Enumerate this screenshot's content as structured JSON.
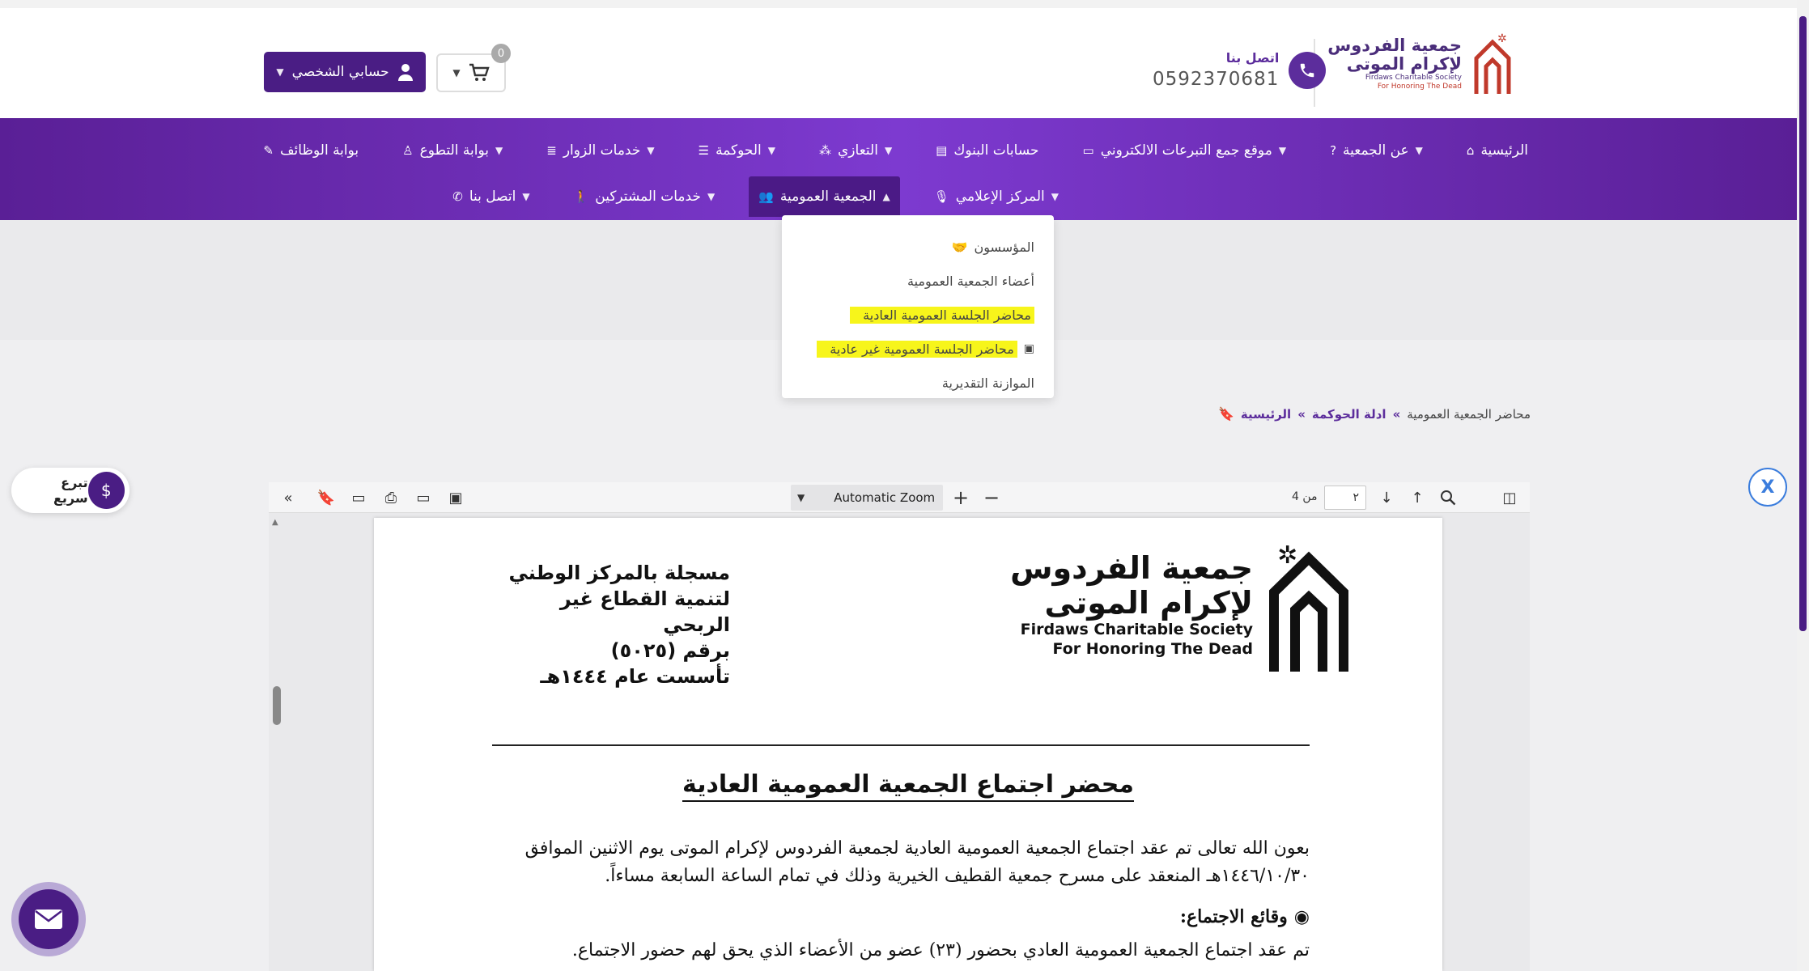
{
  "header": {
    "logo": {
      "line1": "جمعية الفردوس",
      "line2": "لإكرام الموتى",
      "en1": "Firdaws Charitable Society",
      "en2": "For Honoring The Dead"
    },
    "contact": {
      "label": "اتصل بنا",
      "phone": "0592370681"
    },
    "cart": {
      "count": "0"
    },
    "account": {
      "label": "حسابي الشخصي"
    }
  },
  "nav": {
    "row1": [
      {
        "label": "الرئيسية",
        "icon": "home-icon",
        "dropdown": false
      },
      {
        "label": "عن الجمعية",
        "icon": "question-icon",
        "dropdown": true
      },
      {
        "label": "موقع جمع التبرعات الالكتروني",
        "icon": "card-icon",
        "dropdown": true
      },
      {
        "label": "حسابات البنوك",
        "icon": "bank-icon",
        "dropdown": false
      },
      {
        "label": "التعازي",
        "icon": "grid-icon",
        "dropdown": true
      },
      {
        "label": "الحوكمة",
        "icon": "list-icon",
        "dropdown": true
      },
      {
        "label": "خدمات الزوار",
        "icon": "server-icon",
        "dropdown": true
      },
      {
        "label": "بوابة التطوع",
        "icon": "person-icon",
        "dropdown": true
      },
      {
        "label": "بوابة الوظائف",
        "icon": "edit-icon",
        "dropdown": false
      }
    ],
    "row2": [
      {
        "label": "المركز الإعلامي",
        "icon": "mic-icon",
        "dropdown": true
      },
      {
        "label": "الجمعية العمومية",
        "icon": "users-icon",
        "dropdown": true,
        "active": true
      },
      {
        "label": "خدمات المشتركين",
        "icon": "walk-icon",
        "dropdown": true
      },
      {
        "label": "اتصل بنا",
        "icon": "phone-icon",
        "dropdown": true
      }
    ],
    "dropdown_items": [
      "المؤسسون",
      "أعضاء الجمعية العمومية",
      "محاضر الجلسة العمومية العادية",
      "محاضر الجلسة العمومية غير عادية",
      "الموازنة التقديرية"
    ]
  },
  "breadcrumb": {
    "home": "الرئيسية",
    "sep": "»",
    "parent": "ادلة الحوكمة",
    "current": "محاضر الجمعية العمومية"
  },
  "floating": {
    "quick_donate": "تبرع سريع",
    "x_label": "X"
  },
  "viewer": {
    "zoom": "Automatic Zoom",
    "page_current": "٢",
    "page_of": "من 4"
  },
  "document": {
    "logo_ar1": "جمعية الفردوس",
    "logo_ar2": "لإكرام الموتى",
    "logo_en1": "Firdaws Charitable Society",
    "logo_en2": "For Honoring The Dead",
    "reg1": "مسجلة بالمركز الوطني",
    "reg2": "لتنمية القطاع غير الربحي",
    "reg3": "برقم (٥٠٢٥)",
    "reg4": "تأسست عام ١٤٤٤هـ",
    "title": "محضر اجتماع الجمعية العمومية العادية",
    "para1": "بعون الله تعالى تم عقد اجتماع الجمعية العمومية العادية لجمعية الفردوس لإكرام الموتى يوم الاثنين الموافق ١٤٤٦/١٠/٣٠هـ المنعقد على مسرح جمعية القطيف الخيرية وذلك في تمام الساعة السابعة مساءاً.",
    "section": "وقائع الاجتماع:",
    "para2": "تم عقد اجتماع الجمعية العمومية العادي بحضور (٢٣) عضو من الأعضاء الذي يحق لهم حضور الاجتماع."
  },
  "colors": {
    "brand": "#4a1d84",
    "nav": "#6a2bb5",
    "highlight": "#f7f51b",
    "accent": "#3b7ddd"
  }
}
